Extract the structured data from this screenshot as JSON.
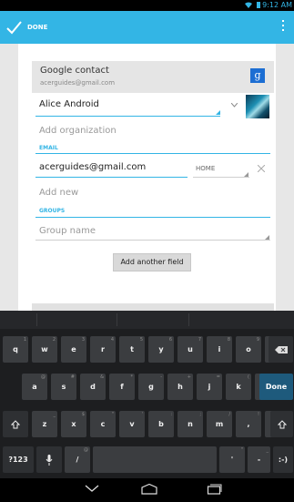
{
  "status_bar": {
    "time": "9:12 AM",
    "wifi_icon": "wifi-icon",
    "battery_icon": "battery-icon"
  },
  "action_bar": {
    "done_label": "DONE",
    "color": "#33b5e5",
    "done_icon": "checkmark-icon",
    "overflow_icon": "overflow-menu-icon"
  },
  "account": {
    "name": "Google contact",
    "email": "acerguides@gmail.com",
    "logo": "g+"
  },
  "contact": {
    "name": "Alice Android",
    "organization_placeholder": "Add organization"
  },
  "email_section": {
    "label": "EMAIL",
    "value": "acerguides@gmail.com",
    "type": "HOME",
    "add_new": "Add new"
  },
  "groups_section": {
    "label": "GROUPS",
    "placeholder": "Group name"
  },
  "add_another_field": "Add another field",
  "keyboard": {
    "row1": [
      {
        "label": "q",
        "hint": "1"
      },
      {
        "label": "w",
        "hint": "2"
      },
      {
        "label": "e",
        "hint": "3"
      },
      {
        "label": "r",
        "hint": "4"
      },
      {
        "label": "t",
        "hint": "5"
      },
      {
        "label": "y",
        "hint": "6"
      },
      {
        "label": "u",
        "hint": "7"
      },
      {
        "label": "i",
        "hint": "8"
      },
      {
        "label": "o",
        "hint": "9"
      },
      {
        "label": "p",
        "hint": "0"
      }
    ],
    "row2": [
      {
        "label": "a",
        "hint": "@"
      },
      {
        "label": "s",
        "hint": "#"
      },
      {
        "label": "d",
        "hint": "&"
      },
      {
        "label": "f",
        "hint": "*"
      },
      {
        "label": "g",
        "hint": "-"
      },
      {
        "label": "h",
        "hint": "+"
      },
      {
        "label": "j",
        "hint": "="
      },
      {
        "label": "k",
        "hint": "("
      },
      {
        "label": "l",
        "hint": ")"
      }
    ],
    "row3": [
      {
        "label": "z",
        "hint": "_"
      },
      {
        "label": "x",
        "hint": "$"
      },
      {
        "label": "c",
        "hint": "\""
      },
      {
        "label": "v",
        "hint": "'"
      },
      {
        "label": "b",
        "hint": ":"
      },
      {
        "label": "n",
        "hint": ";"
      },
      {
        "label": "m",
        "hint": "/"
      },
      {
        "label": ",",
        "hint": "!"
      },
      {
        "label": ".",
        "hint": "?"
      }
    ],
    "done_label": "Done",
    "sym_label": "?123",
    "slash_label": "/",
    "slash_hint": "@",
    "apos_label": "'",
    "apos_hint": "\"",
    "dash_label": "-",
    "dash_hint": "_",
    "smiley_label": ":-)"
  }
}
